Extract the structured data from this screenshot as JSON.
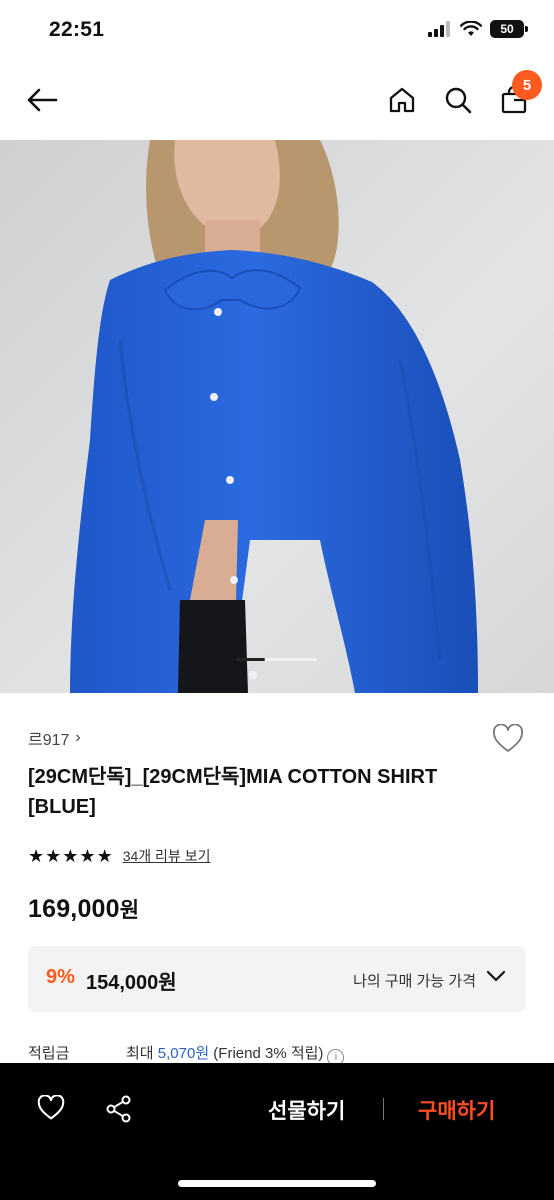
{
  "status_bar": {
    "time": "22:51",
    "battery": "50"
  },
  "header": {
    "cart_count": "5"
  },
  "gallery": {
    "current_slide_fraction": 0.35
  },
  "product": {
    "brand": "르917",
    "brand_chevron": "›",
    "title": "[29CM단독]_[29CM단독]MIA COTTON SHIRT [BLUE]",
    "rating_stars": 5,
    "review_link": "34개 리뷰 보기",
    "price": "169,000",
    "price_unit": "원",
    "discount": {
      "percent": "9%",
      "price": "154,000원",
      "my_price_label": "나의 구매 가능 가격"
    },
    "points": {
      "label": "적립금",
      "prefix": "최대",
      "amount": "5,070원",
      "note": "(Friend 3% 적립)",
      "info": "i"
    }
  },
  "bottom_bar": {
    "gift_label": "선물하기",
    "buy_label": "구매하기"
  },
  "colors": {
    "accent": "#ff5a1f",
    "buy": "#ff4e22",
    "points_link": "#2e62c9",
    "bottom_bg": "#000000"
  },
  "icons": [
    "back-arrow-icon",
    "home-icon",
    "search-icon",
    "shopping-bag-icon",
    "heart-icon",
    "share-icon",
    "chevron-down-icon",
    "info-icon"
  ]
}
